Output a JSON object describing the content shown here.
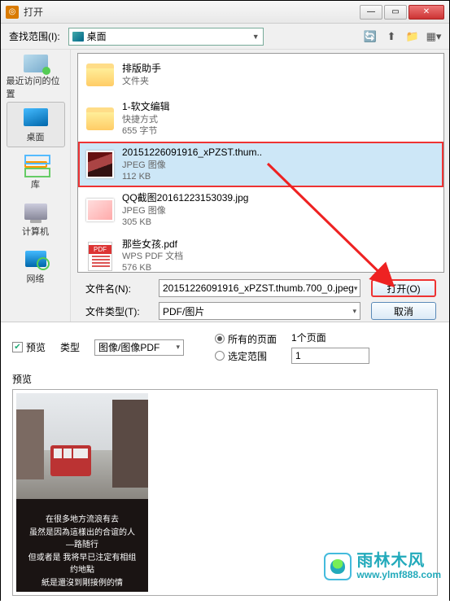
{
  "window": {
    "title": "打开"
  },
  "toolbar": {
    "lookin_label": "查找范围(I):",
    "lookin_value": "桌面"
  },
  "places": {
    "items": [
      {
        "label": "最近访问的位置"
      },
      {
        "label": "桌面"
      },
      {
        "label": "库"
      },
      {
        "label": "计算机"
      },
      {
        "label": "网络"
      }
    ]
  },
  "files": {
    "items": [
      {
        "name": "排版助手",
        "type": "文件夹",
        "size": ""
      },
      {
        "name": "1-软文编辑",
        "type": "快捷方式",
        "size": "655 字节"
      },
      {
        "name": "20151226091916_xPZST.thum..",
        "type": "JPEG 图像",
        "size": "112 KB"
      },
      {
        "name": "QQ截图20161223153039.jpg",
        "type": "JPEG 图像",
        "size": "305 KB"
      },
      {
        "name": "那些女孩.pdf",
        "type": "WPS PDF 文档",
        "size": "576 KB"
      }
    ]
  },
  "filename": {
    "label": "文件名(N):",
    "value": "20151226091916_xPZST.thumb.700_0.jpeg"
  },
  "filetype": {
    "label": "文件类型(T):",
    "value": "PDF/图片"
  },
  "buttons": {
    "open": "打开(O)",
    "cancel": "取消"
  },
  "lower": {
    "preview_chk": "预览",
    "type_label": "类型",
    "type_value": "图像/图像PDF",
    "radio_all": "所有的页面",
    "radio_range": "选定范围",
    "pages_label": "1个页面",
    "pages_value": "1",
    "preview_section": "预览"
  },
  "preview_caption": {
    "line1": "在很多地方流浪有去",
    "line2": "虽然是因為這樣出的合谊的人—路随行",
    "line3": "但或者是 我将早已注定有相组约地點",
    "line4": "紙是還沒到剛接例的情"
  },
  "watermark": {
    "cn": "雨林木风",
    "url": "www.ylmf888.com"
  }
}
